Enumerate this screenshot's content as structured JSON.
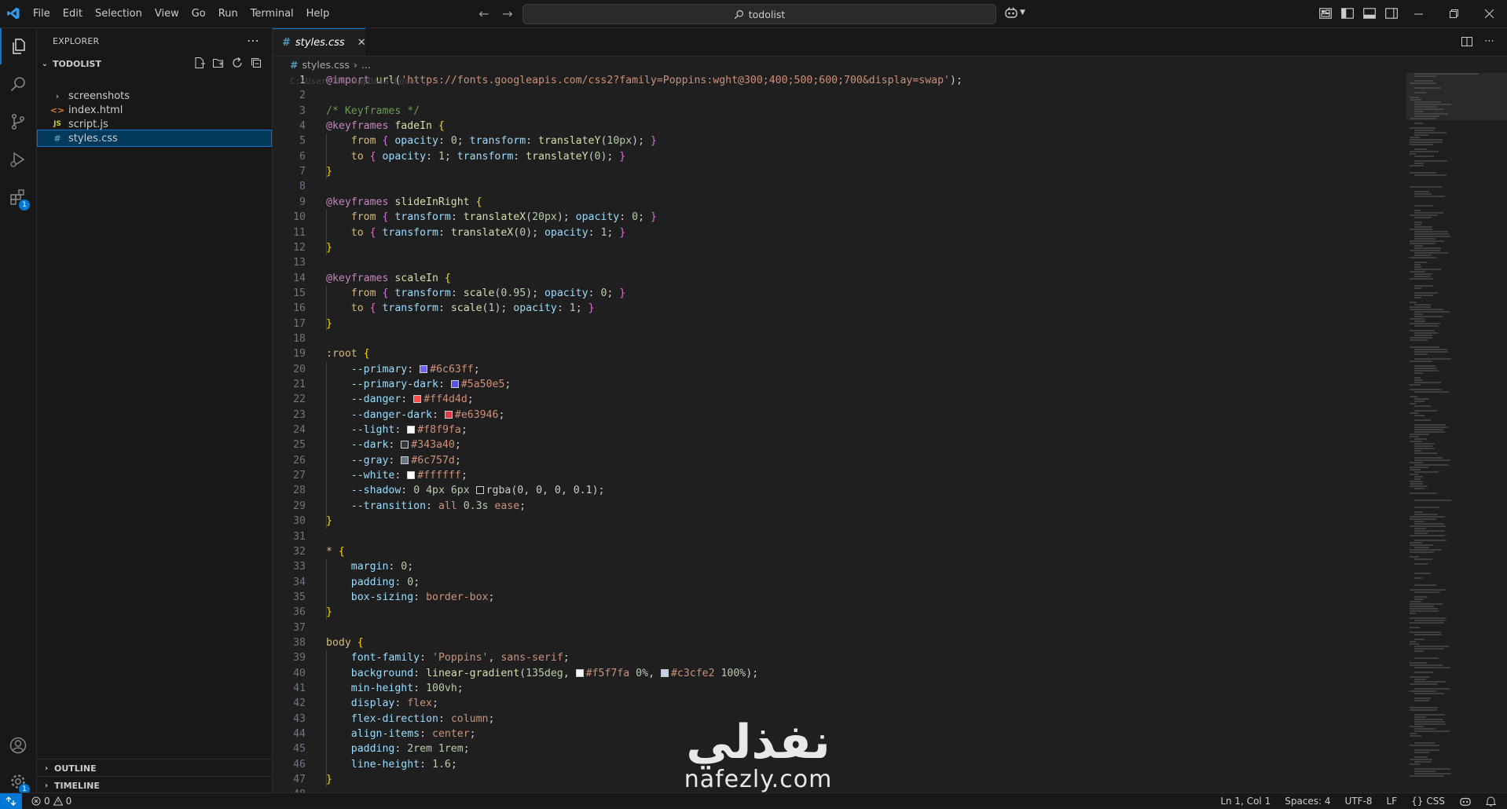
{
  "titlebar": {
    "menu": [
      "File",
      "Edit",
      "Selection",
      "View",
      "Go",
      "Run",
      "Terminal",
      "Help"
    ],
    "search_text": "todolist"
  },
  "colors": {
    "accent": "#0078d4",
    "editor_bg": "#1f1f1f",
    "sidebar_bg": "#181818"
  },
  "activitybar": {
    "extensions_badge": "1",
    "settings_badge": "1"
  },
  "sidebar": {
    "header": "EXPLORER",
    "project": "TODOLIST",
    "items": [
      {
        "label": "screenshots",
        "icon": "chevron-right-icon"
      },
      {
        "label": "index.html",
        "icon": "html-icon",
        "icon_text": "<>"
      },
      {
        "label": "script.js",
        "icon": "js-icon",
        "icon_text": "JS"
      },
      {
        "label": "styles.css",
        "icon": "css-icon",
        "icon_text": "#"
      }
    ],
    "sections": [
      "OUTLINE",
      "TIMELINE"
    ]
  },
  "editor": {
    "tab_label": "styles.css",
    "tab_icon": "#",
    "breadcrumb": [
      "styles.css",
      "..."
    ],
    "ghost_path": "C:\\Users\\PC\\AppData\\Local\\..."
  },
  "code_lines": [
    [
      [
        "t-at",
        "@import "
      ],
      [
        "t-f",
        "url"
      ],
      [
        "t-d",
        "("
      ],
      [
        "t-v",
        "'https://fonts.googleapis.com/css2?family=Poppins:wght@300;400;500;600;700&display=swap'"
      ],
      [
        "t-d",
        ");"
      ]
    ],
    [],
    [
      [
        "t-c",
        "/* Keyframes */"
      ]
    ],
    [
      [
        "t-at",
        "@keyframes "
      ],
      [
        "t-id",
        "fadeIn "
      ],
      [
        "t-b",
        "{"
      ]
    ],
    [
      [
        "t-d",
        "    "
      ],
      [
        "t-s",
        "from "
      ],
      [
        "t-b2",
        "{ "
      ],
      [
        "t-p",
        "opacity"
      ],
      [
        "t-d",
        ": "
      ],
      [
        "t-n",
        "0"
      ],
      [
        "t-d",
        "; "
      ],
      [
        "t-p",
        "transform"
      ],
      [
        "t-d",
        ": "
      ],
      [
        "t-f",
        "translateY"
      ],
      [
        "t-d",
        "("
      ],
      [
        "t-n",
        "10px"
      ],
      [
        "t-d",
        "); "
      ],
      [
        "t-b2",
        "}"
      ]
    ],
    [
      [
        "t-d",
        "    "
      ],
      [
        "t-s",
        "to "
      ],
      [
        "t-b2",
        "{ "
      ],
      [
        "t-p",
        "opacity"
      ],
      [
        "t-d",
        ": "
      ],
      [
        "t-n",
        "1"
      ],
      [
        "t-d",
        "; "
      ],
      [
        "t-p",
        "transform"
      ],
      [
        "t-d",
        ": "
      ],
      [
        "t-f",
        "translateY"
      ],
      [
        "t-d",
        "("
      ],
      [
        "t-n",
        "0"
      ],
      [
        "t-d",
        "); "
      ],
      [
        "t-b2",
        "}"
      ]
    ],
    [
      [
        "t-b",
        "}"
      ]
    ],
    [],
    [
      [
        "t-at",
        "@keyframes "
      ],
      [
        "t-id",
        "slideInRight "
      ],
      [
        "t-b",
        "{"
      ]
    ],
    [
      [
        "t-d",
        "    "
      ],
      [
        "t-s",
        "from "
      ],
      [
        "t-b2",
        "{ "
      ],
      [
        "t-p",
        "transform"
      ],
      [
        "t-d",
        ": "
      ],
      [
        "t-f",
        "translateX"
      ],
      [
        "t-d",
        "("
      ],
      [
        "t-n",
        "20px"
      ],
      [
        "t-d",
        "); "
      ],
      [
        "t-p",
        "opacity"
      ],
      [
        "t-d",
        ": "
      ],
      [
        "t-n",
        "0"
      ],
      [
        "t-d",
        "; "
      ],
      [
        "t-b2",
        "}"
      ]
    ],
    [
      [
        "t-d",
        "    "
      ],
      [
        "t-s",
        "to "
      ],
      [
        "t-b2",
        "{ "
      ],
      [
        "t-p",
        "transform"
      ],
      [
        "t-d",
        ": "
      ],
      [
        "t-f",
        "translateX"
      ],
      [
        "t-d",
        "("
      ],
      [
        "t-n",
        "0"
      ],
      [
        "t-d",
        "); "
      ],
      [
        "t-p",
        "opacity"
      ],
      [
        "t-d",
        ": "
      ],
      [
        "t-n",
        "1"
      ],
      [
        "t-d",
        "; "
      ],
      [
        "t-b2",
        "}"
      ]
    ],
    [
      [
        "t-b",
        "}"
      ]
    ],
    [],
    [
      [
        "t-at",
        "@keyframes "
      ],
      [
        "t-id",
        "scaleIn "
      ],
      [
        "t-b",
        "{"
      ]
    ],
    [
      [
        "t-d",
        "    "
      ],
      [
        "t-s",
        "from "
      ],
      [
        "t-b2",
        "{ "
      ],
      [
        "t-p",
        "transform"
      ],
      [
        "t-d",
        ": "
      ],
      [
        "t-f",
        "scale"
      ],
      [
        "t-d",
        "("
      ],
      [
        "t-n",
        "0.95"
      ],
      [
        "t-d",
        "); "
      ],
      [
        "t-p",
        "opacity"
      ],
      [
        "t-d",
        ": "
      ],
      [
        "t-n",
        "0"
      ],
      [
        "t-d",
        "; "
      ],
      [
        "t-b2",
        "}"
      ]
    ],
    [
      [
        "t-d",
        "    "
      ],
      [
        "t-s",
        "to "
      ],
      [
        "t-b2",
        "{ "
      ],
      [
        "t-p",
        "transform"
      ],
      [
        "t-d",
        ": "
      ],
      [
        "t-f",
        "scale"
      ],
      [
        "t-d",
        "("
      ],
      [
        "t-n",
        "1"
      ],
      [
        "t-d",
        "); "
      ],
      [
        "t-p",
        "opacity"
      ],
      [
        "t-d",
        ": "
      ],
      [
        "t-n",
        "1"
      ],
      [
        "t-d",
        "; "
      ],
      [
        "t-b2",
        "}"
      ]
    ],
    [
      [
        "t-b",
        "}"
      ]
    ],
    [],
    [
      [
        "t-s",
        ":root "
      ],
      [
        "t-b",
        "{"
      ]
    ],
    [
      [
        "t-d",
        "    "
      ],
      [
        "t-p",
        "--primary"
      ],
      [
        "t-d",
        ": "
      ],
      [
        "sw",
        "#6c63ff"
      ],
      [
        "t-v",
        "#6c63ff"
      ],
      [
        "t-d",
        ";"
      ]
    ],
    [
      [
        "t-d",
        "    "
      ],
      [
        "t-p",
        "--primary-dark"
      ],
      [
        "t-d",
        ": "
      ],
      [
        "sw",
        "#5a50e5"
      ],
      [
        "t-v",
        "#5a50e5"
      ],
      [
        "t-d",
        ";"
      ]
    ],
    [
      [
        "t-d",
        "    "
      ],
      [
        "t-p",
        "--danger"
      ],
      [
        "t-d",
        ": "
      ],
      [
        "sw",
        "#ff4d4d"
      ],
      [
        "t-v",
        "#ff4d4d"
      ],
      [
        "t-d",
        ";"
      ]
    ],
    [
      [
        "t-d",
        "    "
      ],
      [
        "t-p",
        "--danger-dark"
      ],
      [
        "t-d",
        ": "
      ],
      [
        "sw",
        "#e63946"
      ],
      [
        "t-v",
        "#e63946"
      ],
      [
        "t-d",
        ";"
      ]
    ],
    [
      [
        "t-d",
        "    "
      ],
      [
        "t-p",
        "--light"
      ],
      [
        "t-d",
        ": "
      ],
      [
        "sw",
        "#f8f9fa"
      ],
      [
        "t-v",
        "#f8f9fa"
      ],
      [
        "t-d",
        ";"
      ]
    ],
    [
      [
        "t-d",
        "    "
      ],
      [
        "t-p",
        "--dark"
      ],
      [
        "t-d",
        ": "
      ],
      [
        "sw",
        "#343a40"
      ],
      [
        "t-v",
        "#343a40"
      ],
      [
        "t-d",
        ";"
      ]
    ],
    [
      [
        "t-d",
        "    "
      ],
      [
        "t-p",
        "--gray"
      ],
      [
        "t-d",
        ": "
      ],
      [
        "sw",
        "#6c757d"
      ],
      [
        "t-v",
        "#6c757d"
      ],
      [
        "t-d",
        ";"
      ]
    ],
    [
      [
        "t-d",
        "    "
      ],
      [
        "t-p",
        "--white"
      ],
      [
        "t-d",
        ": "
      ],
      [
        "sw",
        "#ffffff"
      ],
      [
        "t-v",
        "#ffffff"
      ],
      [
        "t-d",
        ";"
      ]
    ],
    [
      [
        "t-d",
        "    "
      ],
      [
        "t-p",
        "--shadow"
      ],
      [
        "t-d",
        ": "
      ],
      [
        "t-n",
        "0 4px 6px "
      ],
      [
        "sw",
        "rgba(0,0,0,0.1)"
      ],
      [
        "t-d",
        "rgba(0, 0, 0, 0.1);"
      ]
    ],
    [
      [
        "t-d",
        "    "
      ],
      [
        "t-p",
        "--transition"
      ],
      [
        "t-d",
        ": "
      ],
      [
        "t-v",
        "all "
      ],
      [
        "t-n",
        "0.3s "
      ],
      [
        "t-v",
        "ease"
      ],
      [
        "t-d",
        ";"
      ]
    ],
    [
      [
        "t-b",
        "}"
      ]
    ],
    [],
    [
      [
        "t-s",
        "* "
      ],
      [
        "t-b",
        "{"
      ]
    ],
    [
      [
        "t-d",
        "    "
      ],
      [
        "t-p",
        "margin"
      ],
      [
        "t-d",
        ": "
      ],
      [
        "t-n",
        "0"
      ],
      [
        "t-d",
        ";"
      ]
    ],
    [
      [
        "t-d",
        "    "
      ],
      [
        "t-p",
        "padding"
      ],
      [
        "t-d",
        ": "
      ],
      [
        "t-n",
        "0"
      ],
      [
        "t-d",
        ";"
      ]
    ],
    [
      [
        "t-d",
        "    "
      ],
      [
        "t-p",
        "box-sizing"
      ],
      [
        "t-d",
        ": "
      ],
      [
        "t-v",
        "border-box"
      ],
      [
        "t-d",
        ";"
      ]
    ],
    [
      [
        "t-b",
        "}"
      ]
    ],
    [],
    [
      [
        "t-s",
        "body "
      ],
      [
        "t-b",
        "{"
      ]
    ],
    [
      [
        "t-d",
        "    "
      ],
      [
        "t-p",
        "font-family"
      ],
      [
        "t-d",
        ": "
      ],
      [
        "t-v",
        "'Poppins'"
      ],
      [
        "t-d",
        ", "
      ],
      [
        "t-v",
        "sans-serif"
      ],
      [
        "t-d",
        ";"
      ]
    ],
    [
      [
        "t-d",
        "    "
      ],
      [
        "t-p",
        "background"
      ],
      [
        "t-d",
        ": "
      ],
      [
        "t-f",
        "linear-gradient"
      ],
      [
        "t-d",
        "("
      ],
      [
        "t-n",
        "135deg"
      ],
      [
        "t-d",
        ", "
      ],
      [
        "sw",
        "#f5f7fa"
      ],
      [
        "t-v",
        "#f5f7fa "
      ],
      [
        "t-n",
        "0%"
      ],
      [
        "t-d",
        ", "
      ],
      [
        "sw",
        "#c3cfe2"
      ],
      [
        "t-v",
        "#c3cfe2 "
      ],
      [
        "t-n",
        "100%"
      ],
      [
        "t-d",
        ");"
      ]
    ],
    [
      [
        "t-d",
        "    "
      ],
      [
        "t-p",
        "min-height"
      ],
      [
        "t-d",
        ": "
      ],
      [
        "t-n",
        "100vh"
      ],
      [
        "t-d",
        ";"
      ]
    ],
    [
      [
        "t-d",
        "    "
      ],
      [
        "t-p",
        "display"
      ],
      [
        "t-d",
        ": "
      ],
      [
        "t-v",
        "flex"
      ],
      [
        "t-d",
        ";"
      ]
    ],
    [
      [
        "t-d",
        "    "
      ],
      [
        "t-p",
        "flex-direction"
      ],
      [
        "t-d",
        ": "
      ],
      [
        "t-v",
        "column"
      ],
      [
        "t-d",
        ";"
      ]
    ],
    [
      [
        "t-d",
        "    "
      ],
      [
        "t-p",
        "align-items"
      ],
      [
        "t-d",
        ": "
      ],
      [
        "t-v",
        "center"
      ],
      [
        "t-d",
        ";"
      ]
    ],
    [
      [
        "t-d",
        "    "
      ],
      [
        "t-p",
        "padding"
      ],
      [
        "t-d",
        ": "
      ],
      [
        "t-n",
        "2rem 1rem"
      ],
      [
        "t-d",
        ";"
      ]
    ],
    [
      [
        "t-d",
        "    "
      ],
      [
        "t-p",
        "line-height"
      ],
      [
        "t-d",
        ": "
      ],
      [
        "t-n",
        "1.6"
      ],
      [
        "t-d",
        ";"
      ]
    ],
    [
      [
        "t-b",
        "}"
      ]
    ],
    [],
    [
      [
        "t-d",
        "    "
      ],
      [
        "t-s",
        "."
      ],
      [
        "t-s",
        "todo"
      ],
      [
        "t-d",
        " "
      ],
      [
        "t-b",
        "{"
      ]
    ]
  ],
  "watermark": {
    "arabic": "نفذلي",
    "latin": "nafezly.com"
  },
  "statusbar": {
    "errors": "0",
    "warnings": "0",
    "position": "Ln 1, Col 1",
    "spaces": "Spaces: 4",
    "encoding": "UTF-8",
    "eol": "LF",
    "language": "CSS"
  }
}
